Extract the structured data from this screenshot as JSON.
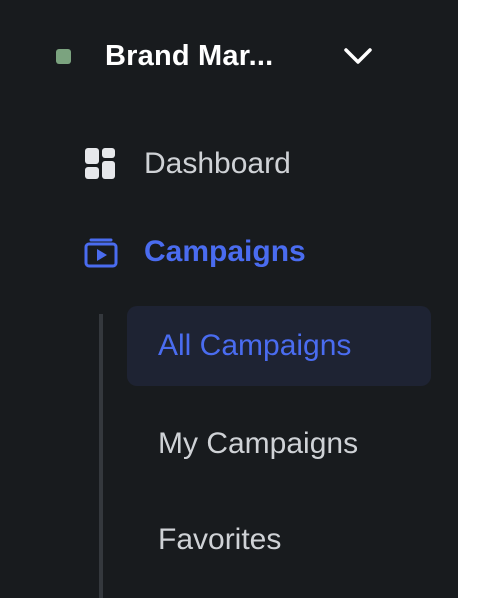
{
  "workspace": {
    "name": "Brand Mar...",
    "status_color": "#7ba37f",
    "icons": {
      "status": "status-dot-icon",
      "expand": "chevron-down-icon"
    }
  },
  "nav": {
    "dashboard": {
      "label": "Dashboard",
      "icon": "dashboard-grid-icon"
    },
    "campaigns": {
      "label": "Campaigns",
      "icon": "media-play-icon",
      "active": true,
      "children": [
        {
          "label": "All Campaigns",
          "active": true
        },
        {
          "label": "My Campaigns",
          "active": false
        },
        {
          "label": "Favorites",
          "active": false
        }
      ]
    }
  },
  "colors": {
    "sidebar_bg": "#181b1e",
    "accent": "#4a6cf0",
    "text": "#cfd2d6",
    "active_bg": "#1e2333"
  }
}
